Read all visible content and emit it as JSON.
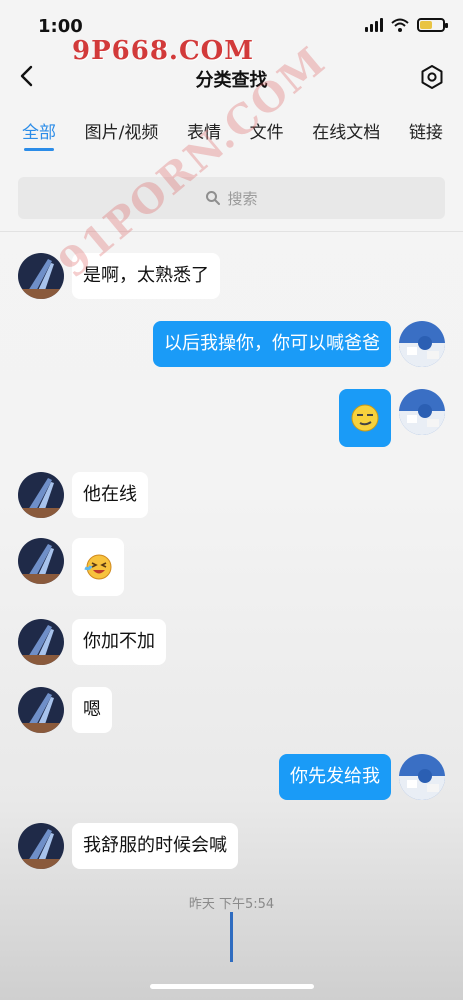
{
  "status": {
    "time": "1:00"
  },
  "watermark_top": "9P668.COM",
  "watermark_center": "91PORN.COM",
  "nav": {
    "title": "分类查找"
  },
  "tabs": [
    "全部",
    "图片/视频",
    "表情",
    "文件",
    "在线文档",
    "链接"
  ],
  "search": {
    "placeholder": "搜索"
  },
  "messages": [
    {
      "side": "left",
      "type": "text",
      "text": "是啊，太熟悉了"
    },
    {
      "side": "right",
      "type": "text",
      "text": "以后我操你，你可以喊爸爸"
    },
    {
      "side": "right",
      "type": "emoji",
      "icon": "smirk-emoji-icon"
    },
    {
      "side": "left",
      "type": "text",
      "text": "他在线"
    },
    {
      "side": "left",
      "type": "emoji",
      "icon": "laugh-cry-emoji-icon"
    },
    {
      "side": "left",
      "type": "text",
      "text": "你加不加"
    },
    {
      "side": "left",
      "type": "text",
      "text": "嗯"
    },
    {
      "side": "right",
      "type": "text",
      "text": "你先发给我"
    },
    {
      "side": "left",
      "type": "text",
      "text": "我舒服的时候会喊"
    }
  ],
  "timestamp": "昨天 下午5:54",
  "colors": {
    "accent": "#2b8ce8",
    "bubble_right": "#1a9bf7",
    "bubble_left": "#ffffff",
    "battery": "#e9c443"
  }
}
